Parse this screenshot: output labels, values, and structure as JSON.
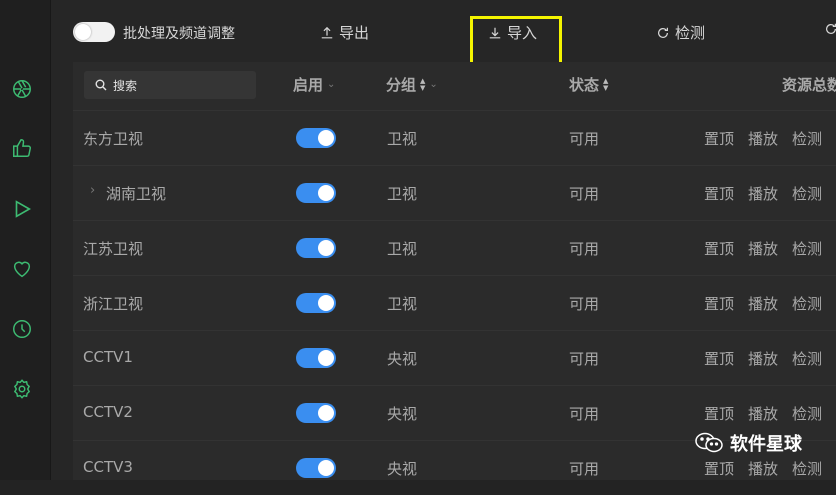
{
  "toolbar": {
    "batch_label": "批处理及频道调整",
    "export_label": "导出",
    "import_label": "导入",
    "check_label": "检测",
    "highlight_color": "#f4f400"
  },
  "sidebar": {
    "items": [
      {
        "icon": "aperture-icon"
      },
      {
        "icon": "thumbs-up-icon"
      },
      {
        "icon": "play-icon"
      },
      {
        "icon": "heart-icon"
      },
      {
        "icon": "clock-icon"
      },
      {
        "icon": "gear-icon"
      }
    ],
    "accent": "#3dbb72"
  },
  "table": {
    "search_placeholder": "搜索",
    "headers": {
      "enabled": "启用",
      "group": "分组",
      "status": "状态",
      "resources": "资源总数"
    },
    "rows": [
      {
        "name": "东方卫视",
        "enabled": true,
        "group": "卫视",
        "status": "可用",
        "expandable": false
      },
      {
        "name": "湖南卫视",
        "enabled": true,
        "group": "卫视",
        "status": "可用",
        "expandable": true
      },
      {
        "name": "江苏卫视",
        "enabled": true,
        "group": "卫视",
        "status": "可用",
        "expandable": false
      },
      {
        "name": "浙江卫视",
        "enabled": true,
        "group": "卫视",
        "status": "可用",
        "expandable": false
      },
      {
        "name": "CCTV1",
        "enabled": true,
        "group": "央视",
        "status": "可用",
        "expandable": false
      },
      {
        "name": "CCTV2",
        "enabled": true,
        "group": "央视",
        "status": "可用",
        "expandable": false
      },
      {
        "name": "CCTV3",
        "enabled": true,
        "group": "央视",
        "status": "可用",
        "expandable": false
      }
    ],
    "actions": {
      "pin": "置顶",
      "play": "播放",
      "check": "检测"
    },
    "switch_color": "#3a8ef0"
  },
  "watermark": {
    "text": "软件星球",
    "icon": "wechat-icon"
  }
}
